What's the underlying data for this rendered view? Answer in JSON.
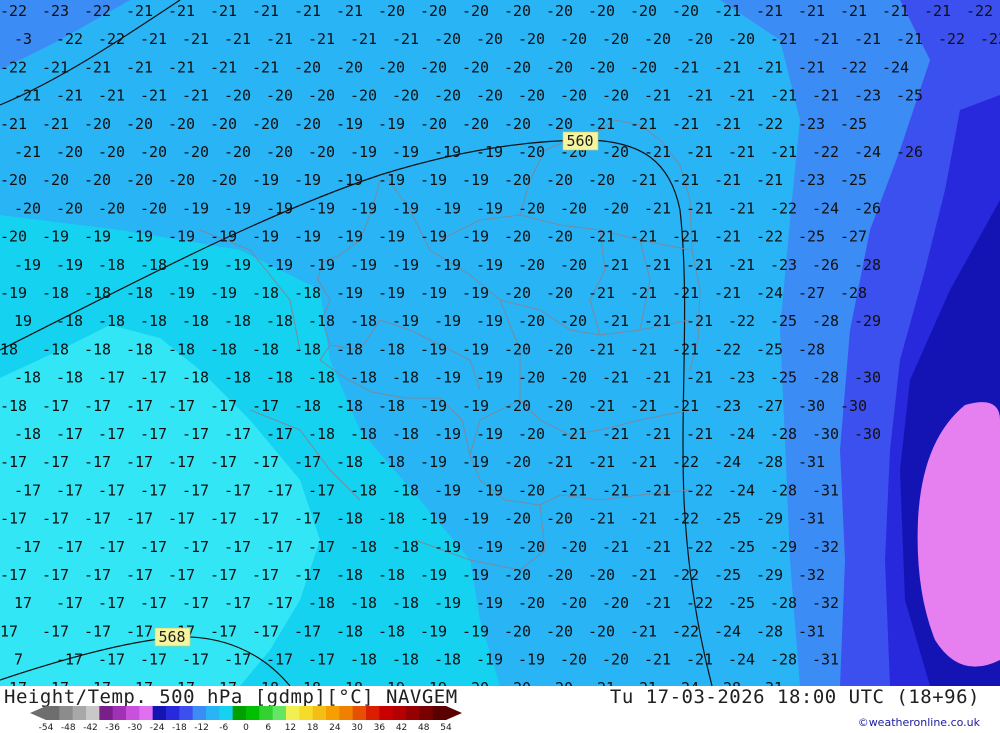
{
  "map": {
    "contour_labels": {
      "c560": "560",
      "c568": "568"
    },
    "temperature_rows": [
      [
        "-22",
        "-23",
        "-22",
        "-21",
        "-21",
        "-21",
        "-21",
        "-21",
        "-21",
        "-20",
        "-20",
        "-20",
        "-20",
        "-20",
        "-20",
        "-20",
        "-20",
        "-21",
        "-21",
        "-21",
        "-21",
        "-21",
        "-21",
        "-22"
      ],
      [
        "-3",
        "-22",
        "-22",
        "-21",
        "-21",
        "-21",
        "-21",
        "-21",
        "-21",
        "-21",
        "-20",
        "-20",
        "-20",
        "-20",
        "-20",
        "-20",
        "-20",
        "-20",
        "-21",
        "-21",
        "-21",
        "-21",
        "-22",
        "-23"
      ],
      [
        "-22",
        "-21",
        "-21",
        "-21",
        "-21",
        "-21",
        "-21",
        "-20",
        "-20",
        "-20",
        "-20",
        "-20",
        "-20",
        "-20",
        "-20",
        "-20",
        "-21",
        "-21",
        "-21",
        "-21",
        "-22",
        "-24"
      ],
      [
        "-21",
        "-21",
        "-21",
        "-21",
        "-21",
        "-20",
        "-20",
        "-20",
        "-20",
        "-20",
        "-20",
        "-20",
        "-20",
        "-20",
        "-20",
        "-21",
        "-21",
        "-21",
        "-21",
        "-21",
        "-23",
        "-25"
      ],
      [
        "-21",
        "-21",
        "-20",
        "-20",
        "-20",
        "-20",
        "-20",
        "-20",
        "-19",
        "-19",
        "-20",
        "-20",
        "-20",
        "-20",
        "-21",
        "-21",
        "-21",
        "-21",
        "-22",
        "-23",
        "-25"
      ],
      [
        "-21",
        "-20",
        "-20",
        "-20",
        "-20",
        "-20",
        "-20",
        "-20",
        "-19",
        "-19",
        "-19",
        "-19",
        "-20",
        "-20",
        "-20",
        "-21",
        "-21",
        "-21",
        "-21",
        "-22",
        "-24",
        "-26"
      ],
      [
        "-20",
        "-20",
        "-20",
        "-20",
        "-20",
        "-20",
        "-19",
        "-19",
        "-19",
        "-19",
        "-19",
        "-19",
        "-20",
        "-20",
        "-20",
        "-21",
        "-21",
        "-21",
        "-21",
        "-23",
        "-25"
      ],
      [
        "-20",
        "-20",
        "-20",
        "-20",
        "-19",
        "-19",
        "-19",
        "-19",
        "-19",
        "-19",
        "-19",
        "-19",
        "-20",
        "-20",
        "-20",
        "-21",
        "-21",
        "-21",
        "-22",
        "-24",
        "-26"
      ],
      [
        "-20",
        "-19",
        "-19",
        "-19",
        "-19",
        "-19",
        "-19",
        "-19",
        "-19",
        "-19",
        "-19",
        "-19",
        "-20",
        "-20",
        "-21",
        "-21",
        "-21",
        "-21",
        "-22",
        "-25",
        "-27"
      ],
      [
        "-19",
        "-19",
        "-18",
        "-18",
        "-19",
        "-19",
        "-19",
        "-19",
        "-19",
        "-19",
        "-19",
        "-19",
        "-20",
        "-20",
        "-21",
        "-21",
        "-21",
        "-21",
        "-23",
        "-26",
        "-28"
      ],
      [
        "-19",
        "-18",
        "-18",
        "-18",
        "-19",
        "-19",
        "-18",
        "-18",
        "-19",
        "-19",
        "-19",
        "-19",
        "-20",
        "-20",
        "-21",
        "-21",
        "-21",
        "-21",
        "-24",
        "-27",
        "-28"
      ],
      [
        "19",
        "-18",
        "-18",
        "-18",
        "-18",
        "-18",
        "-18",
        "-18",
        "-18",
        "-19",
        "-19",
        "-19",
        "-20",
        "-20",
        "-21",
        "-21",
        "-21",
        "-22",
        "-25",
        "-28",
        "-29"
      ],
      [
        "18",
        "-18",
        "-18",
        "-18",
        "-18",
        "-18",
        "-18",
        "-18",
        "-18",
        "-18",
        "-19",
        "-19",
        "-20",
        "-20",
        "-21",
        "-21",
        "-21",
        "-22",
        "-25",
        "-28"
      ],
      [
        "-18",
        "-18",
        "-17",
        "-17",
        "-18",
        "-18",
        "-18",
        "-18",
        "-18",
        "-18",
        "-19",
        "-19",
        "-20",
        "-20",
        "-21",
        "-21",
        "-21",
        "-23",
        "-25",
        "-28",
        "-30"
      ],
      [
        "-18",
        "-17",
        "-17",
        "-17",
        "-17",
        "-17",
        "-17",
        "-18",
        "-18",
        "-18",
        "-19",
        "-19",
        "-20",
        "-20",
        "-21",
        "-21",
        "-21",
        "-23",
        "-27",
        "-30",
        "-30"
      ],
      [
        "-18",
        "-17",
        "-17",
        "-17",
        "-17",
        "-17",
        "-17",
        "-18",
        "-18",
        "-18",
        "-19",
        "-19",
        "-20",
        "-21",
        "-21",
        "-21",
        "-21",
        "-24",
        "-28",
        "-30",
        "-30"
      ],
      [
        "-17",
        "-17",
        "-17",
        "-17",
        "-17",
        "-17",
        "-17",
        "-17",
        "-18",
        "-18",
        "-19",
        "-19",
        "-20",
        "-21",
        "-21",
        "-21",
        "-22",
        "-24",
        "-28",
        "-31"
      ],
      [
        "-17",
        "-17",
        "-17",
        "-17",
        "-17",
        "-17",
        "-17",
        "-17",
        "-18",
        "-18",
        "-19",
        "-19",
        "-20",
        "-21",
        "-21",
        "-21",
        "-22",
        "-24",
        "-28",
        "-31"
      ],
      [
        "-17",
        "-17",
        "-17",
        "-17",
        "-17",
        "-17",
        "-17",
        "-17",
        "-18",
        "-18",
        "-19",
        "-19",
        "-20",
        "-20",
        "-21",
        "-21",
        "-22",
        "-25",
        "-29",
        "-31"
      ],
      [
        "-17",
        "-17",
        "-17",
        "-17",
        "-17",
        "-17",
        "-17",
        "-17",
        "-18",
        "-18",
        "-19",
        "-19",
        "-20",
        "-20",
        "-21",
        "-21",
        "-22",
        "-25",
        "-29",
        "-32"
      ],
      [
        "-17",
        "-17",
        "-17",
        "-17",
        "-17",
        "-17",
        "-17",
        "-17",
        "-18",
        "-18",
        "-19",
        "-19",
        "-20",
        "-20",
        "-20",
        "-21",
        "-22",
        "-25",
        "-29",
        "-32"
      ],
      [
        "17",
        "-17",
        "-17",
        "-17",
        "-17",
        "-17",
        "-17",
        "-18",
        "-18",
        "-18",
        "-19",
        "-19",
        "-20",
        "-20",
        "-20",
        "-21",
        "-22",
        "-25",
        "-28",
        "-32"
      ],
      [
        "17",
        "-17",
        "-17",
        "-17",
        "-17",
        "-17",
        "-17",
        "-17",
        "-18",
        "-18",
        "-19",
        "-19",
        "-20",
        "-20",
        "-20",
        "-21",
        "-22",
        "-24",
        "-28",
        "-31"
      ],
      [
        "7",
        "-17",
        "-17",
        "-17",
        "-17",
        "-17",
        "-17",
        "-17",
        "-18",
        "-18",
        "-18",
        "-19",
        "-19",
        "-20",
        "-20",
        "-21",
        "-21",
        "-24",
        "-28",
        "-31"
      ],
      [
        "-17",
        "-17",
        "-17",
        "-17",
        "-17",
        "-17",
        "-18",
        "-18",
        "-18",
        "-19",
        "-19",
        "-20",
        "-20",
        "-20",
        "-21",
        "-21",
        "-24",
        "-28",
        "-31"
      ],
      [
        "-17",
        "-17",
        "-17",
        "-17",
        "-17",
        "-17",
        "-18",
        "-18",
        "-18",
        "-19",
        "-19",
        "-20",
        "-20",
        "-20",
        "-21",
        "-21",
        "-24",
        "-28",
        "-31"
      ]
    ]
  },
  "footer": {
    "title_left": "Height/Temp. 500 hPa [gdmp][°C] NAVGEM",
    "title_right": "Tu 17-03-2026 18:00 UTC (18+96)",
    "credit": "©weatheronline.co.uk",
    "scale": {
      "labels": [
        "-54",
        "-48",
        "-42",
        "-36",
        "-30",
        "-24",
        "-18",
        "-12",
        "-6",
        "0",
        "6",
        "12",
        "18",
        "24",
        "30",
        "36",
        "42",
        "48",
        "54"
      ],
      "colors": [
        "#6e6e6e",
        "#8c8c8c",
        "#a8a8a8",
        "#c8c8c8",
        "#7a1e8c",
        "#a030b4",
        "#c850dc",
        "#e070f0",
        "#1414b4",
        "#2828dc",
        "#3c50f0",
        "#3c8cf5",
        "#28b4f5",
        "#14d2f0",
        "#00a000",
        "#00be00",
        "#32d232",
        "#64e664",
        "#f0f050",
        "#f5dc28",
        "#f5be14",
        "#f5a000",
        "#f08000",
        "#e65000",
        "#dc1e00",
        "#c80000",
        "#b40000",
        "#960000",
        "#780000",
        "#5a0000"
      ]
    }
  }
}
